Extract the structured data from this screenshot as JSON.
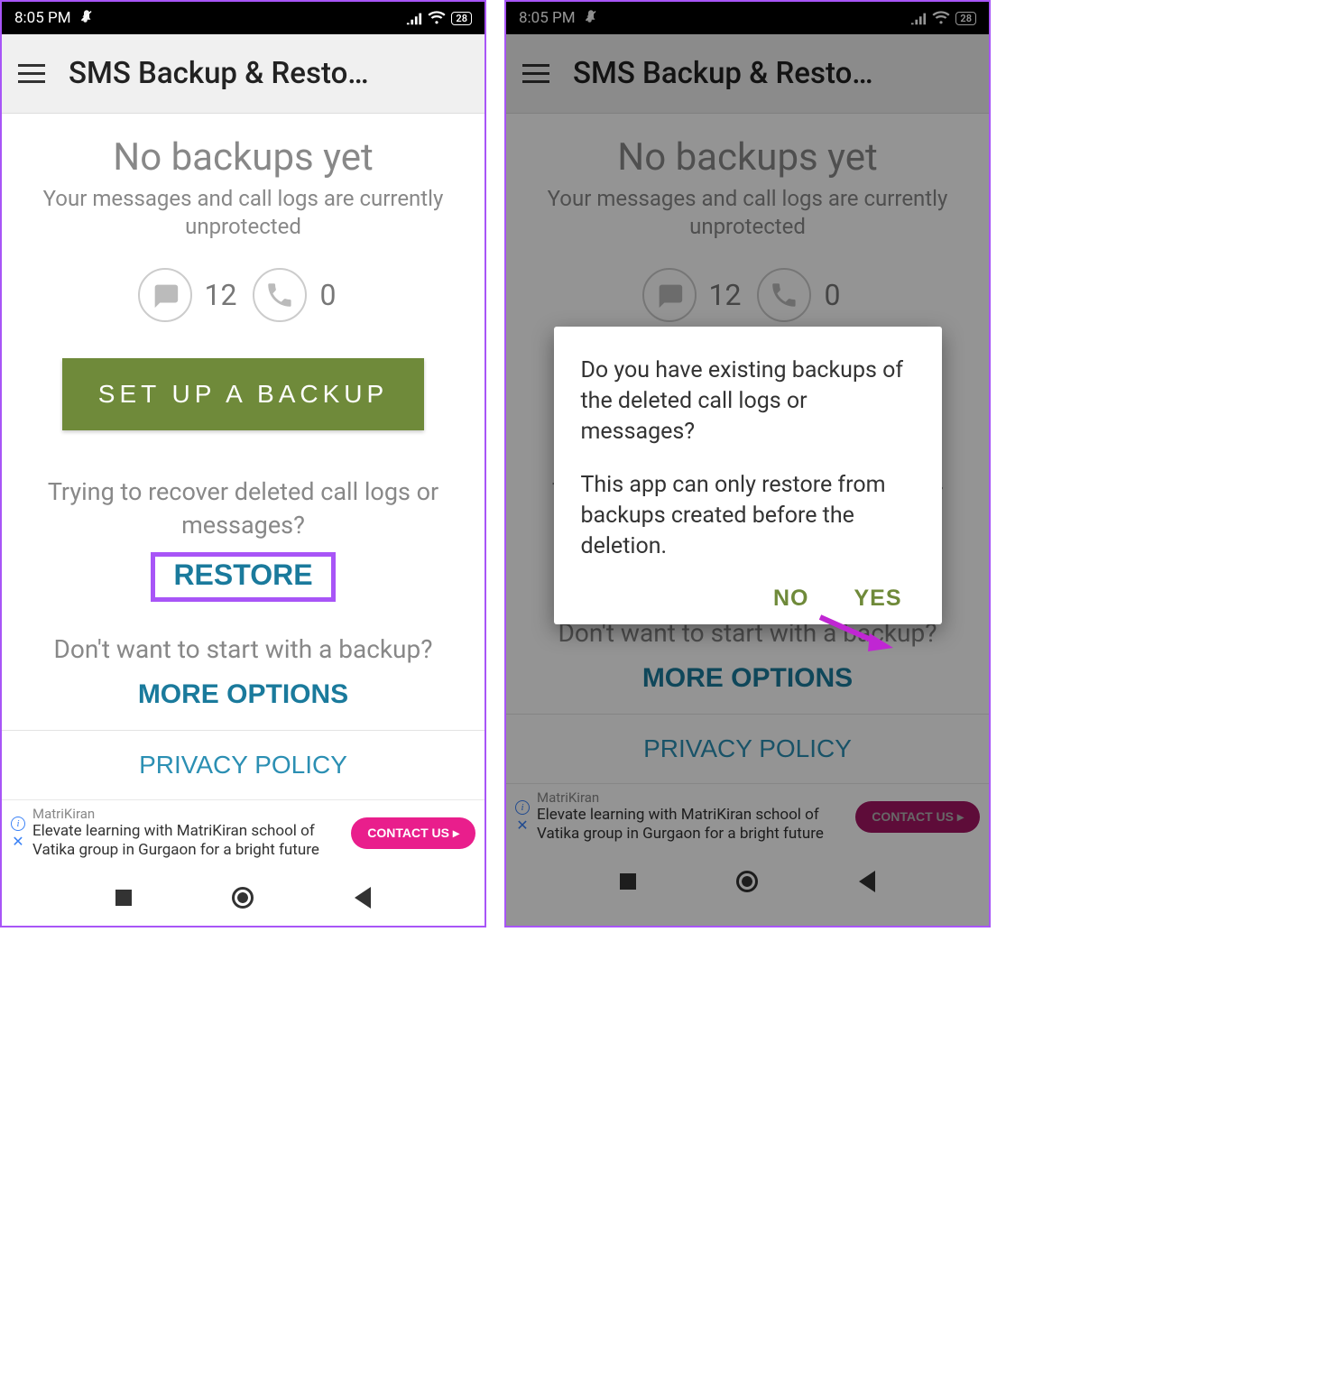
{
  "status": {
    "time": "8:05 PM",
    "battery": "28"
  },
  "appbar": {
    "title": "SMS Backup & Resto…"
  },
  "main": {
    "heading": "No backups yet",
    "subheading": "Your messages and call logs are currently unprotected",
    "sms_count": "12",
    "call_count": "0",
    "setup_label": "SET UP A BACKUP",
    "recover_text": "Trying to recover deleted call logs or messages?",
    "restore_label": "RESTORE",
    "dontwant_text": "Don't want to start with a backup?",
    "more_options_label": "MORE OPTIONS",
    "privacy_label": "PRIVACY POLICY"
  },
  "ad": {
    "sponsor": "MatriKiran",
    "body": "Elevate learning with MatriKiran school of Vatika group in Gurgaon for a bright future",
    "cta": "CONTACT US"
  },
  "dialog": {
    "p1": "Do you have existing backups of the deleted call logs or messages?",
    "p2": "This app can only restore from backups created before the deletion.",
    "no": "NO",
    "yes": "YES"
  },
  "annotations": {
    "restore_highlight_color": "#a855f7",
    "arrow_color": "#c026d3"
  }
}
